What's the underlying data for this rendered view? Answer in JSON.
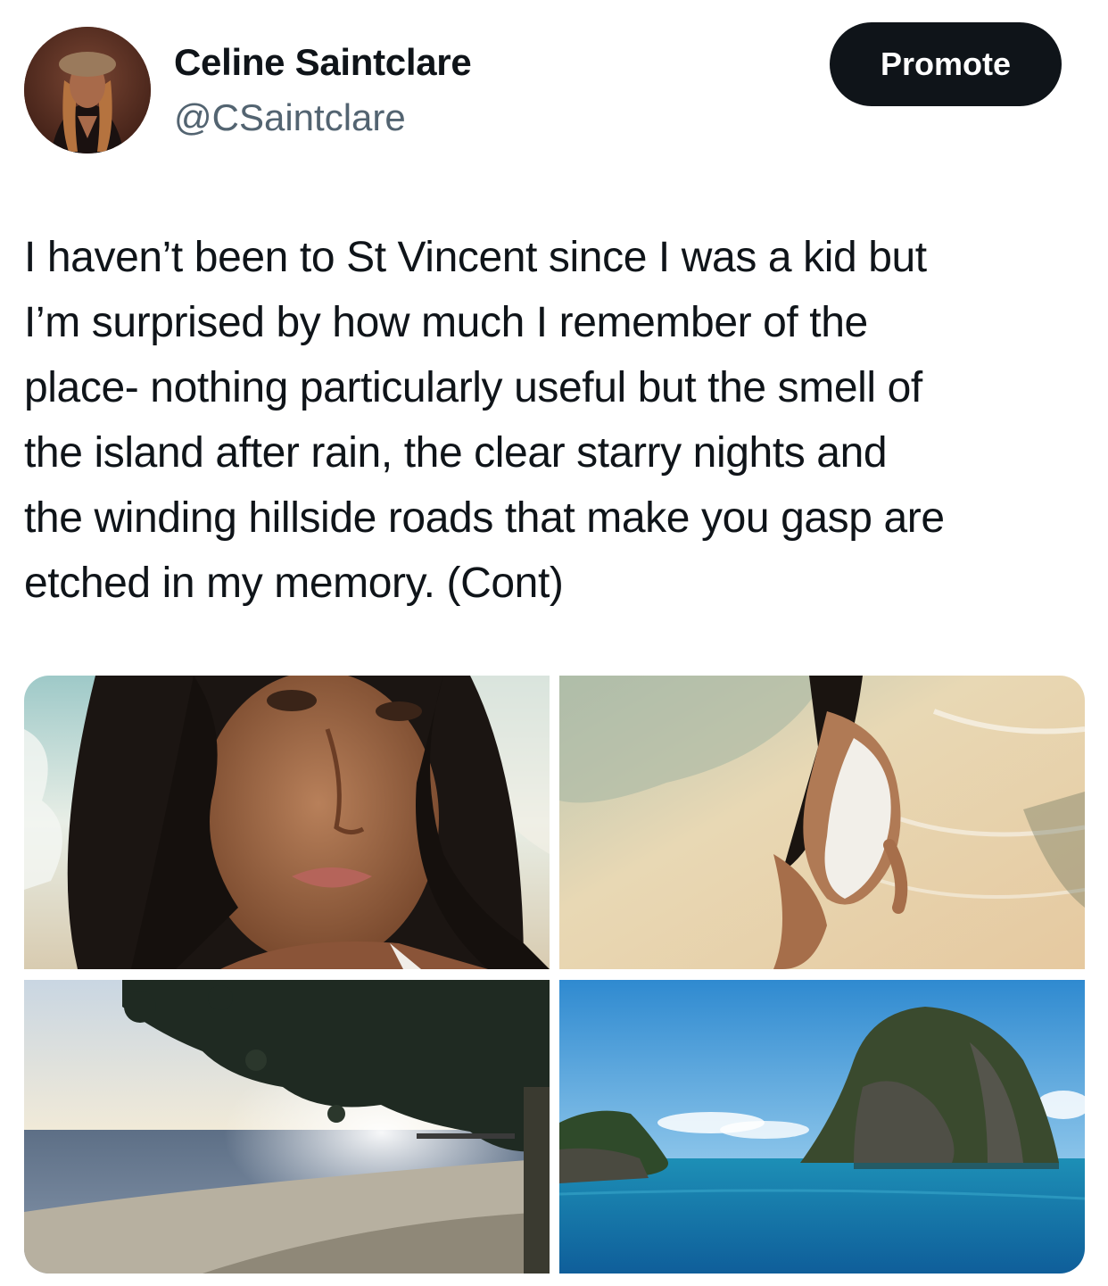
{
  "tweet": {
    "author_name": "Celine Saintclare",
    "author_handle": "@CSaintclare",
    "promote_label": "Promote",
    "text_lines": [
      "I haven’t been to St Vincent since I was a kid but",
      "I’m surprised by how much I remember of the",
      "place- nothing particularly useful but the smell of",
      "the island after rain, the clear starry nights and",
      "the winding hillside roads that make you gasp are",
      "etched in my memory. (Cont)"
    ]
  },
  "colors": {
    "text": "#0f1419",
    "secondary_text": "#536471",
    "button_bg": "#0f1419",
    "button_text": "#ffffff"
  }
}
